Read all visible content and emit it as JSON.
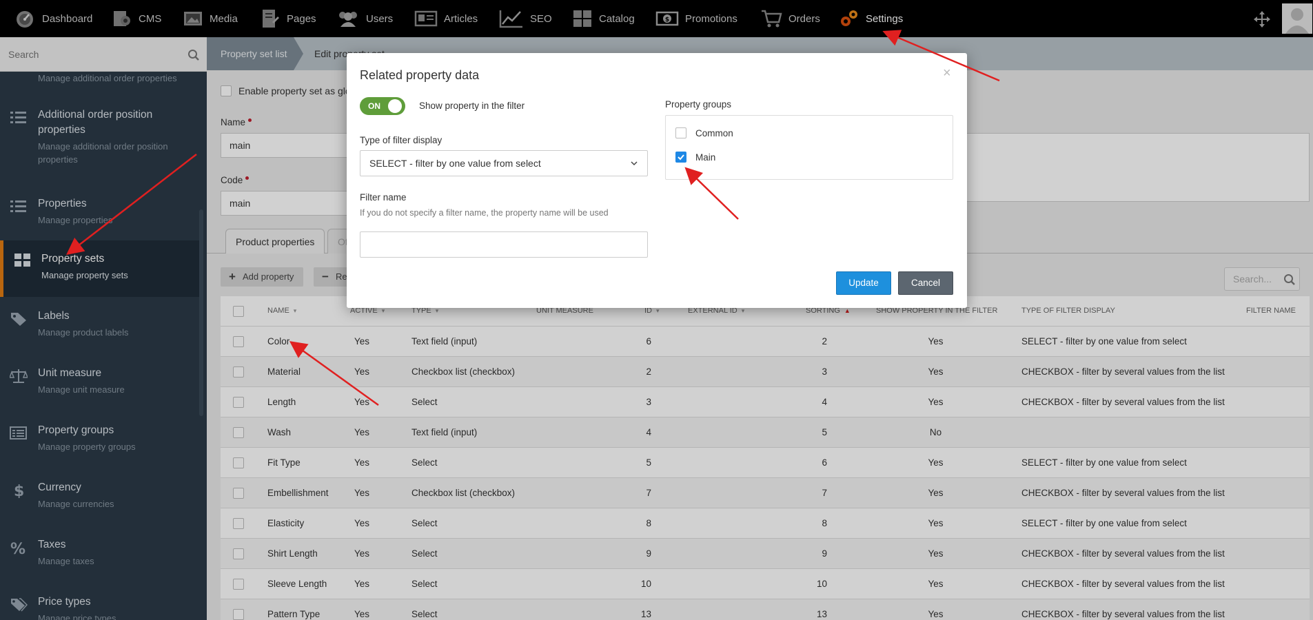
{
  "topnav": {
    "items": [
      {
        "label": "Dashboard",
        "icon": "dashboard-icon"
      },
      {
        "label": "CMS",
        "icon": "cms-icon"
      },
      {
        "label": "Media",
        "icon": "media-icon"
      },
      {
        "label": "Pages",
        "icon": "pages-icon"
      },
      {
        "label": "Users",
        "icon": "users-icon"
      },
      {
        "label": "Articles",
        "icon": "articles-icon"
      },
      {
        "label": "SEO",
        "icon": "seo-icon"
      },
      {
        "label": "Catalog",
        "icon": "catalog-icon"
      },
      {
        "label": "Promotions",
        "icon": "promotions-icon"
      },
      {
        "label": "Orders",
        "icon": "cart-icon"
      },
      {
        "label": "Settings",
        "icon": "gears-icon"
      }
    ],
    "active": "Settings"
  },
  "sidebar": {
    "search_placeholder": "Search",
    "top_desc": "Manage additional order properties",
    "items": [
      {
        "title": "Additional order position properties",
        "desc": "Manage additional order position properties",
        "icon": "list-icon"
      },
      {
        "title": "Properties",
        "desc": "Manage properties",
        "icon": "list-icon"
      },
      {
        "title": "Property sets",
        "desc": "Manage property sets",
        "icon": "grid-icon"
      },
      {
        "title": "Labels",
        "desc": "Manage product labels",
        "icon": "tag-icon"
      },
      {
        "title": "Unit measure",
        "desc": "Manage unit measure",
        "icon": "scale-icon"
      },
      {
        "title": "Property groups",
        "desc": "Manage property groups",
        "icon": "table-icon"
      },
      {
        "title": "Currency",
        "desc": "Manage currencies",
        "icon": "dollar-icon"
      },
      {
        "title": "Taxes",
        "desc": "Manage taxes",
        "icon": "percent-icon"
      },
      {
        "title": "Price types",
        "desc": "Manage price types",
        "icon": "tags-icon"
      }
    ]
  },
  "breadcrumb": {
    "first": "Property set list",
    "second": "Edit property set"
  },
  "form": {
    "enable_label": "Enable property set as global",
    "name_label": "Name",
    "name_value": "main",
    "code_label": "Code",
    "code_value": "main"
  },
  "tabs": {
    "active": "Product properties",
    "other": "Other"
  },
  "toolbar": {
    "add_label": "Add property",
    "remove_label": "Remove",
    "search_placeholder": "Search..."
  },
  "table": {
    "headers": {
      "name": "NAME",
      "active": "ACTIVE",
      "type": "TYPE",
      "unit": "UNIT MEASURE",
      "id": "ID",
      "external_id": "EXTERNAL ID",
      "sorting": "SORTING",
      "show": "SHOW PROPERTY IN THE FILTER",
      "filter_type": "TYPE OF FILTER DISPLAY",
      "filter_name": "FILTER NAME"
    },
    "rows": [
      {
        "name": "Color",
        "active": "Yes",
        "type": "Text field (input)",
        "id": "6",
        "sorting": "2",
        "show": "Yes",
        "filter": "SELECT - filter by one value from select"
      },
      {
        "name": "Material",
        "active": "Yes",
        "type": "Checkbox list (checkbox)",
        "id": "2",
        "sorting": "3",
        "show": "Yes",
        "filter": "CHECKBOX - filter by several values from the list"
      },
      {
        "name": "Length",
        "active": "Yes",
        "type": "Select",
        "id": "3",
        "sorting": "4",
        "show": "Yes",
        "filter": "CHECKBOX - filter by several values from the list"
      },
      {
        "name": "Wash",
        "active": "Yes",
        "type": "Text field (input)",
        "id": "4",
        "sorting": "5",
        "show": "No",
        "filter": ""
      },
      {
        "name": "Fit Type",
        "active": "Yes",
        "type": "Select",
        "id": "5",
        "sorting": "6",
        "show": "Yes",
        "filter": "SELECT - filter by one value from select"
      },
      {
        "name": "Embellishment",
        "active": "Yes",
        "type": "Checkbox list (checkbox)",
        "id": "7",
        "sorting": "7",
        "show": "Yes",
        "filter": "CHECKBOX - filter by several values from the list"
      },
      {
        "name": "Elasticity",
        "active": "Yes",
        "type": "Select",
        "id": "8",
        "sorting": "8",
        "show": "Yes",
        "filter": "SELECT - filter by one value from select"
      },
      {
        "name": "Shirt Length",
        "active": "Yes",
        "type": "Select",
        "id": "9",
        "sorting": "9",
        "show": "Yes",
        "filter": "CHECKBOX - filter by several values from the list"
      },
      {
        "name": "Sleeve Length",
        "active": "Yes",
        "type": "Select",
        "id": "10",
        "sorting": "10",
        "show": "Yes",
        "filter": "CHECKBOX - filter by several values from the list"
      },
      {
        "name": "Pattern Type",
        "active": "Yes",
        "type": "Select",
        "id": "13",
        "sorting": "13",
        "show": "Yes",
        "filter": "CHECKBOX - filter by several values from the list"
      }
    ]
  },
  "modal": {
    "title": "Related property data",
    "close": "×",
    "toggle_label": "ON",
    "show_label": "Show property in the filter",
    "filter_type_label": "Type of filter display",
    "filter_type_value": "SELECT - filter by one value from select",
    "filter_name_label": "Filter name",
    "filter_name_hint": "If you do not specify a filter name, the property name will be used",
    "filter_name_value": "",
    "groups_label": "Property groups",
    "groups": [
      {
        "label": "Common",
        "checked": false
      },
      {
        "label": "Main",
        "checked": true
      }
    ],
    "update_label": "Update",
    "cancel_label": "Cancel"
  },
  "colors": {
    "accent": "#e27d13",
    "primary_button": "#1e90dd",
    "annotation_arrow": "#e02020"
  }
}
